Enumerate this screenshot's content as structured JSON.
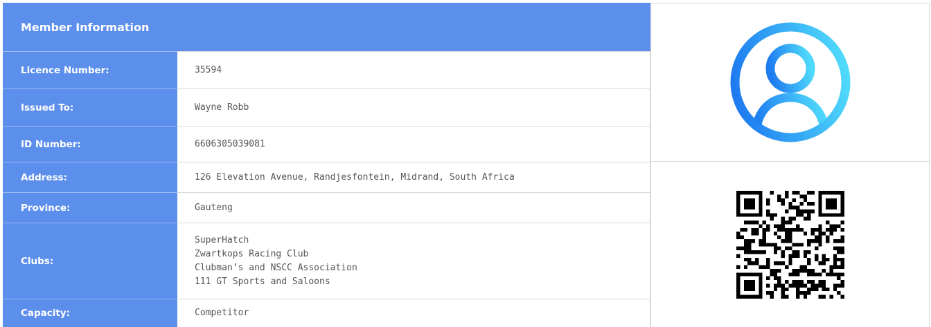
{
  "header": {
    "title": "Member Information"
  },
  "fields": [
    {
      "key": "licence",
      "label": "Licence Number:",
      "value": "35594"
    },
    {
      "key": "issued",
      "label": "Issued To:",
      "value": "Wayne Robb"
    },
    {
      "key": "id",
      "label": "ID Number:",
      "value": "6606305039081"
    },
    {
      "key": "address",
      "label": "Address:",
      "value": "126 Elevation Avenue, Randjesfontein, Midrand, South Africa"
    },
    {
      "key": "province",
      "label": "Province:",
      "value": "Gauteng"
    },
    {
      "key": "clubs",
      "label": "Clubs:",
      "values": [
        "SuperHatch",
        "Zwartkops Racing Club",
        "Clubman’s and NSCC Association",
        "111 GT Sports and Saloons"
      ]
    },
    {
      "key": "capacity",
      "label": "Capacity:",
      "value": "Competitor"
    }
  ],
  "avatar": {
    "icon": "user-avatar-icon",
    "gradient_start": "#1e7bf0",
    "gradient_end": "#4fd9fb"
  },
  "qr": {
    "icon": "qr-code-icon"
  },
  "colors": {
    "accent": "#5c8eec",
    "text": "#555555"
  }
}
